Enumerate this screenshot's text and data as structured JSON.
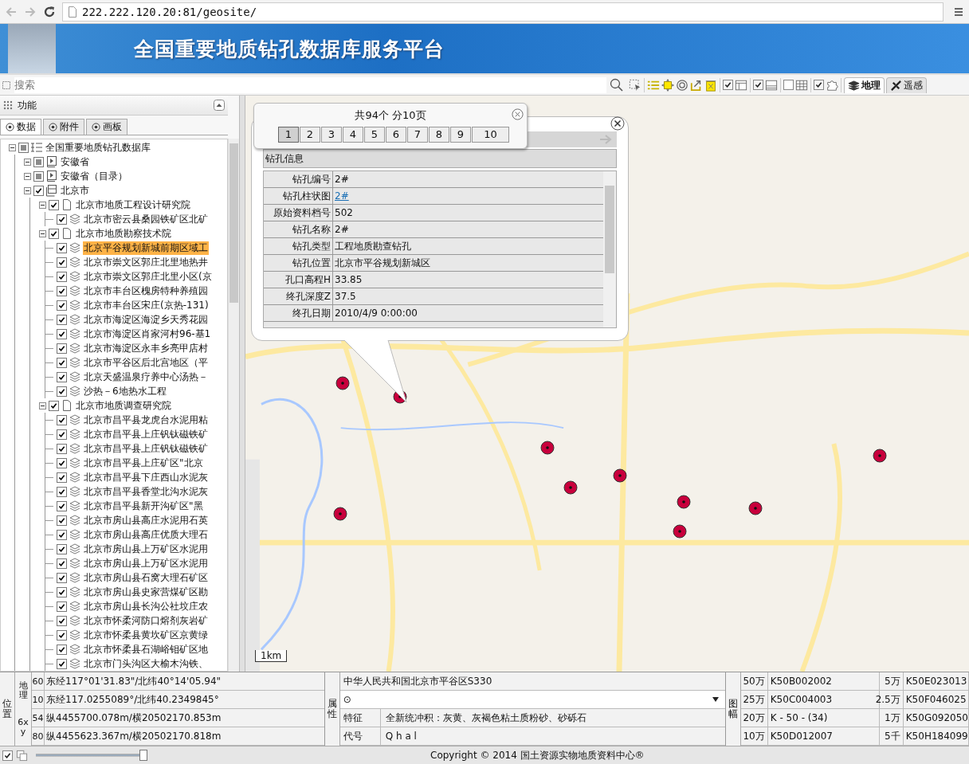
{
  "browser": {
    "url": "222.222.120.20:81/geosite/"
  },
  "banner": {
    "title": "全国重要地质钻孔数据库服务平台"
  },
  "search": {
    "placeholder": "搜索"
  },
  "toolbar": {
    "toggles": [
      {
        "checked": true
      },
      {
        "checked": true
      },
      {
        "checked": false
      },
      {
        "checked": true
      }
    ]
  },
  "map_tabs": [
    {
      "label": "地理",
      "selected": true
    },
    {
      "label": "遥感",
      "selected": false
    }
  ],
  "panel": {
    "title": "功能",
    "tabs": [
      {
        "label": "数据",
        "selected": true
      },
      {
        "label": "附件",
        "selected": false
      },
      {
        "label": "画板",
        "selected": false
      }
    ]
  },
  "tree": {
    "label": "全国重要地质钻孔数据库",
    "kind": "database",
    "checked": false,
    "partial": true,
    "expanded": true,
    "selected": false,
    "children": [
      {
        "label": "安徽省",
        "kind": "province",
        "checked": false,
        "partial": true,
        "expanded": true,
        "selected": false
      },
      {
        "label": "安徽省（目录）",
        "kind": "province",
        "checked": false,
        "partial": true,
        "expanded": true,
        "selected": false
      },
      {
        "label": "北京市",
        "kind": "city",
        "checked": true,
        "partial": false,
        "expanded": true,
        "selected": false,
        "children": [
          {
            "label": "北京市地质工程设计研究院",
            "kind": "institute",
            "checked": true,
            "partial": false,
            "expanded": true,
            "selected": false,
            "children": [
              {
                "label": "北京市密云县桑园铁矿区北矿",
                "kind": "project",
                "checked": true,
                "partial": false,
                "selected": false
              }
            ]
          },
          {
            "label": "北京市地质勘察技术院",
            "kind": "institute",
            "checked": true,
            "partial": false,
            "expanded": true,
            "selected": false,
            "children": [
              {
                "label": "北京平谷规划新城前期区域工",
                "kind": "project",
                "checked": true,
                "partial": false,
                "selected": true
              },
              {
                "label": "北京市崇文区郭庄北里地热井",
                "kind": "project",
                "checked": true,
                "partial": false,
                "selected": false
              },
              {
                "label": "北京市崇文区郭庄北里小区(京",
                "kind": "project",
                "checked": true,
                "partial": false,
                "selected": false
              },
              {
                "label": "北京市丰台区槐房特种养殖园",
                "kind": "project",
                "checked": true,
                "partial": false,
                "selected": false
              },
              {
                "label": "北京市丰台区宋庄(京热-131)",
                "kind": "project",
                "checked": true,
                "partial": false,
                "selected": false
              },
              {
                "label": "北京市海淀区海淀乡天秀花园",
                "kind": "project",
                "checked": true,
                "partial": false,
                "selected": false
              },
              {
                "label": "北京市海淀区肖家河村96-基1",
                "kind": "project",
                "checked": true,
                "partial": false,
                "selected": false
              },
              {
                "label": "北京市海淀区永丰乡亮甲店村",
                "kind": "project",
                "checked": true,
                "partial": false,
                "selected": false
              },
              {
                "label": "北京市平谷区后北宫地区（平",
                "kind": "project",
                "checked": true,
                "partial": false,
                "selected": false
              },
              {
                "label": "北京天盛温泉疗养中心汤热－",
                "kind": "project",
                "checked": true,
                "partial": false,
                "selected": false
              },
              {
                "label": "沙热－6地热水工程",
                "kind": "project",
                "checked": true,
                "partial": false,
                "selected": false
              }
            ]
          },
          {
            "label": "北京市地质调查研究院",
            "kind": "institute",
            "checked": true,
            "partial": false,
            "expanded": true,
            "selected": false,
            "children": [
              {
                "label": "北京市昌平县龙虎台水泥用粘",
                "kind": "project",
                "checked": true,
                "partial": false,
                "selected": false
              },
              {
                "label": "北京市昌平县上庄钒钛磁铁矿",
                "kind": "project",
                "checked": true,
                "partial": false,
                "selected": false
              },
              {
                "label": "北京市昌平县上庄钒钛磁铁矿",
                "kind": "project",
                "checked": true,
                "partial": false,
                "selected": false
              },
              {
                "label": "北京市昌平县上庄矿区\"北京",
                "kind": "project",
                "checked": true,
                "partial": false,
                "selected": false
              },
              {
                "label": "北京市昌平县下庄西山水泥灰",
                "kind": "project",
                "checked": true,
                "partial": false,
                "selected": false
              },
              {
                "label": "北京市昌平县香堂北沟水泥灰",
                "kind": "project",
                "checked": true,
                "partial": false,
                "selected": false
              },
              {
                "label": "北京市昌平县新开沟矿区\"黑",
                "kind": "project",
                "checked": true,
                "partial": false,
                "selected": false
              },
              {
                "label": "北京市房山县高庄水泥用石英",
                "kind": "project",
                "checked": true,
                "partial": false,
                "selected": false
              },
              {
                "label": "北京市房山县高庄优质大理石",
                "kind": "project",
                "checked": true,
                "partial": false,
                "selected": false
              },
              {
                "label": "北京市房山县上万矿区水泥用",
                "kind": "project",
                "checked": true,
                "partial": false,
                "selected": false
              },
              {
                "label": "北京市房山县上万矿区水泥用",
                "kind": "project",
                "checked": true,
                "partial": false,
                "selected": false
              },
              {
                "label": "北京市房山县石窝大理石矿区",
                "kind": "project",
                "checked": true,
                "partial": false,
                "selected": false
              },
              {
                "label": "北京市房山县史家营煤矿区勘",
                "kind": "project",
                "checked": true,
                "partial": false,
                "selected": false
              },
              {
                "label": "北京市房山县长沟公社坟庄农",
                "kind": "project",
                "checked": true,
                "partial": false,
                "selected": false
              },
              {
                "label": "北京市怀柔河防口熔剂灰岩矿",
                "kind": "project",
                "checked": true,
                "partial": false,
                "selected": false
              },
              {
                "label": "北京市怀柔县黄坎矿区京黄绿",
                "kind": "project",
                "checked": true,
                "partial": false,
                "selected": false
              },
              {
                "label": "北京市怀柔县石湖峪钼矿区地",
                "kind": "project",
                "checked": true,
                "partial": false,
                "selected": false
              },
              {
                "label": "北京市门头沟区大榆木沟铁、",
                "kind": "project",
                "checked": true,
                "partial": false,
                "selected": false
              }
            ]
          }
        ]
      }
    ]
  },
  "pager": {
    "summary": "共94个 分10页",
    "pages": [
      {
        "label": "1",
        "selected": true
      },
      {
        "label": "2",
        "selected": false
      },
      {
        "label": "3",
        "selected": false
      },
      {
        "label": "4",
        "selected": false
      },
      {
        "label": "5",
        "selected": false
      },
      {
        "label": "6",
        "selected": false
      },
      {
        "label": "7",
        "selected": false
      },
      {
        "label": "8",
        "selected": false
      },
      {
        "label": "9",
        "selected": false
      },
      {
        "label": "10",
        "selected": false
      }
    ]
  },
  "info": {
    "title": "钻孔信息",
    "rows": [
      {
        "label": "钻孔编号",
        "value": "2#",
        "kind": "text"
      },
      {
        "label": "钻孔柱状图",
        "value": "2#",
        "kind": "link"
      },
      {
        "label": "原始资料档号",
        "value": "502",
        "kind": "text"
      },
      {
        "label": "钻孔名称",
        "value": "2#",
        "kind": "text"
      },
      {
        "label": "钻孔类型",
        "value": "工程地质勘查钻孔",
        "kind": "text"
      },
      {
        "label": "钻孔位置",
        "value": "北京市平谷规划新城区",
        "kind": "text"
      },
      {
        "label": "孔口高程H",
        "value": "33.85",
        "kind": "text"
      },
      {
        "label": "终孔深度Z",
        "value": "37.5",
        "kind": "text"
      },
      {
        "label": "终孔日期",
        "value": "2010/4/9 0:00:00",
        "kind": "text"
      }
    ]
  },
  "scale": {
    "label": "1km"
  },
  "position": {
    "title": "位置",
    "groups": [
      {
        "label": "地理",
        "rows": [
          {
            "code": "60",
            "value": "东经117°01'31.83\"/北纬40°14'05.94\""
          },
          {
            "code": "10",
            "value": "东经117.0255089°/北纬40.2349845°"
          }
        ]
      },
      {
        "label": "6xy",
        "rows": [
          {
            "code": "54",
            "value": "纵4455700.078m/横20502170.853m"
          },
          {
            "code": "80",
            "value": "纵4455623.367m/横20502170.818m"
          }
        ]
      }
    ]
  },
  "attributes": {
    "title": "属性",
    "place": "中华人民共和国北京市平谷区S330",
    "select": {
      "value": "⊙"
    },
    "rows": [
      {
        "label": "特征",
        "value": "全新统冲积：灰黄、灰褐色粘土质粉砂、砂砾石"
      },
      {
        "label": "代号",
        "value": "Q h a l"
      }
    ]
  },
  "sheets": {
    "title": "图幅",
    "rows": [
      {
        "left": {
          "scale": "50万",
          "code": "K50B002002"
        },
        "right": {
          "scale": "5万",
          "code": "K50E023013"
        }
      },
      {
        "left": {
          "scale": "25万",
          "code": "K50C004003"
        },
        "right": {
          "scale": "2.5万",
          "code": "K50F046025"
        }
      },
      {
        "left": {
          "scale": "20万",
          "code": "K - 50 - (34)"
        },
        "right": {
          "scale": "1万",
          "code": "K50G092050"
        }
      },
      {
        "left": {
          "scale": "10万",
          "code": "K50D012007"
        },
        "right": {
          "scale": "5千",
          "code": "K50H184099"
        }
      }
    ]
  },
  "footer": {
    "checked": true,
    "level": 1,
    "copyright": "Copyright © 2014 国土资源实物地质资料中心®"
  }
}
